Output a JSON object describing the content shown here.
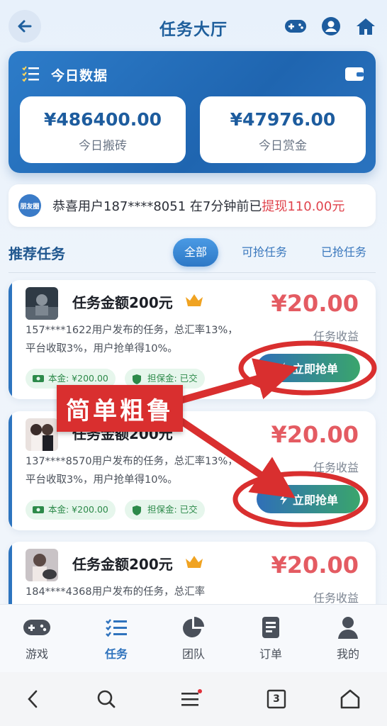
{
  "header": {
    "title": "任务大厅"
  },
  "today": {
    "title": "今日数据",
    "stats": [
      {
        "value": "¥486400.00",
        "label": "今日搬砖"
      },
      {
        "value": "¥47976.00",
        "label": "今日赏金"
      }
    ]
  },
  "notice": {
    "badge": "朋友圈",
    "text": "恭喜用户187****8051 在7分钟前已",
    "amount": "提现110.00元"
  },
  "section": {
    "title": "推荐任务",
    "tabs": [
      "全部",
      "可抢任务",
      "已抢任务"
    ]
  },
  "tasks": [
    {
      "title": "任务金额200元",
      "reward": "¥20.00",
      "reward_label": "任务收益",
      "desc": "157****1622用户发布的任务，总汇率13%，平台收取3%，用户抢单得10%。",
      "principal": "本金: ¥200.00",
      "deposit": "担保金: 已交",
      "button": "立即抢单"
    },
    {
      "title": "任务金额200元",
      "reward": "¥20.00",
      "reward_label": "任务收益",
      "desc": "137****8570用户发布的任务，总汇率13%，平台收取3%，用户抢单得10%。",
      "principal": "本金: ¥200.00",
      "deposit": "担保金: 已交",
      "button": "立即抢单"
    },
    {
      "title": "任务金额200元",
      "reward": "¥20.00",
      "reward_label": "任务收益",
      "desc": "184****4368用户发布的任务，总汇率",
      "principal": "",
      "deposit": "",
      "button": ""
    }
  ],
  "annotation": {
    "label": "简单粗鲁",
    "color": "#d92f2f"
  },
  "tabbar": [
    {
      "label": "游戏",
      "icon": "gamepad-icon"
    },
    {
      "label": "任务",
      "icon": "task-list-icon",
      "active": true
    },
    {
      "label": "团队",
      "icon": "pie-chart-icon"
    },
    {
      "label": "订单",
      "icon": "order-icon"
    },
    {
      "label": "我的",
      "icon": "user-icon"
    }
  ],
  "sysnav": {
    "tab_count": "3"
  },
  "colors": {
    "primary": "#2d74bf",
    "reward": "#e45b62",
    "accent_green": "#3aa56c"
  }
}
